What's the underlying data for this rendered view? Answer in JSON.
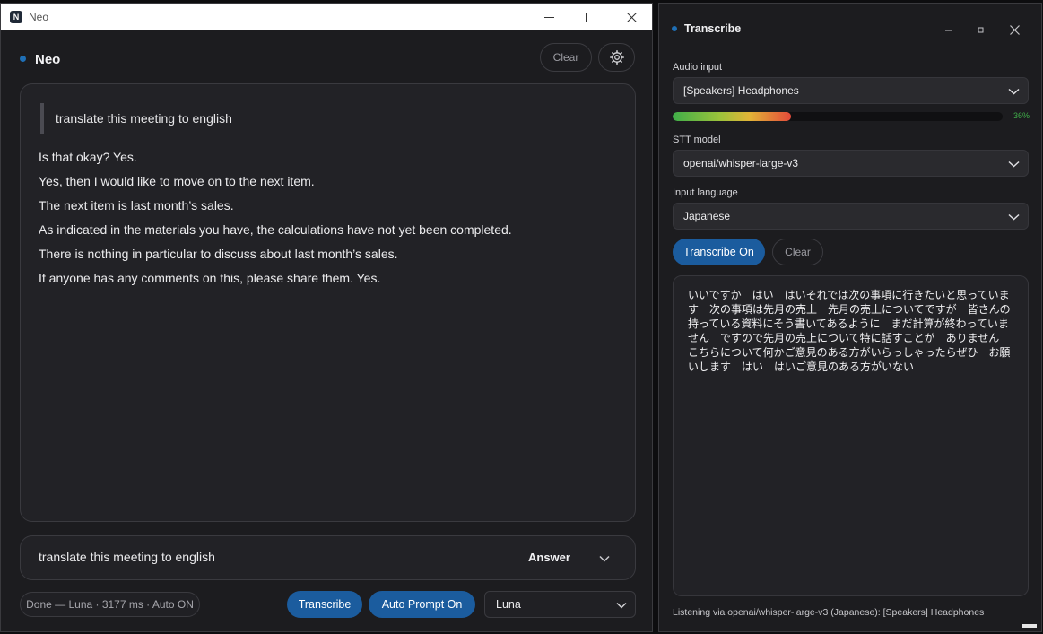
{
  "neo_window": {
    "title": "Neo",
    "app_icon_letter": "N",
    "heading": "Neo",
    "clear_label": "Clear",
    "settings_icon": "gear-icon",
    "prompt_quote": "translate this meeting to english",
    "answer_lines": [
      "Is that okay? Yes.",
      "Yes, then I would like to move on to the next item.",
      "The next item is last month’s sales.",
      "As indicated in the materials you have, the calculations have not yet been completed.",
      "There is nothing in particular to discuss about last month’s sales.",
      "If anyone has any comments on this, please share them. Yes."
    ],
    "prompt_input_value": "translate this meeting to english",
    "mode_label": "Answer",
    "status_text": "Done — Luna · 3177 ms · Auto ON",
    "transcribe_label": "Transcribe",
    "auto_prompt_label": "Auto Prompt On",
    "model_selected": "Luna",
    "accent_color": "#1b5c9e"
  },
  "transcribe_window": {
    "title": "Transcribe",
    "audio_input_label": "Audio input",
    "audio_input_value": "[Speakers] Headphones",
    "level_percent": 36,
    "level_text": "36%",
    "stt_model_label": "STT model",
    "stt_model_value": "openai/whisper-large-v3",
    "language_label": "Input language",
    "language_value": "Japanese",
    "transcribe_on_label": "Transcribe On",
    "clear_label": "Clear",
    "transcript": "いいですか　はい　はいそれでは次の事項に行きたいと思っています　次の事項は先月の売上　先月の売上についてですが　皆さんの持っている資料にそう書いてあるように　まだ計算が終わっていません　ですので先月の売上について特に話すことが　ありません　こちらについて何かご意見のある方がいらっしゃったらぜひ　お願いします　はい　はいご意見のある方がいない",
    "status_text": "Listening via openai/whisper-large-v3 (Japanese): [Speakers] Headphones"
  }
}
